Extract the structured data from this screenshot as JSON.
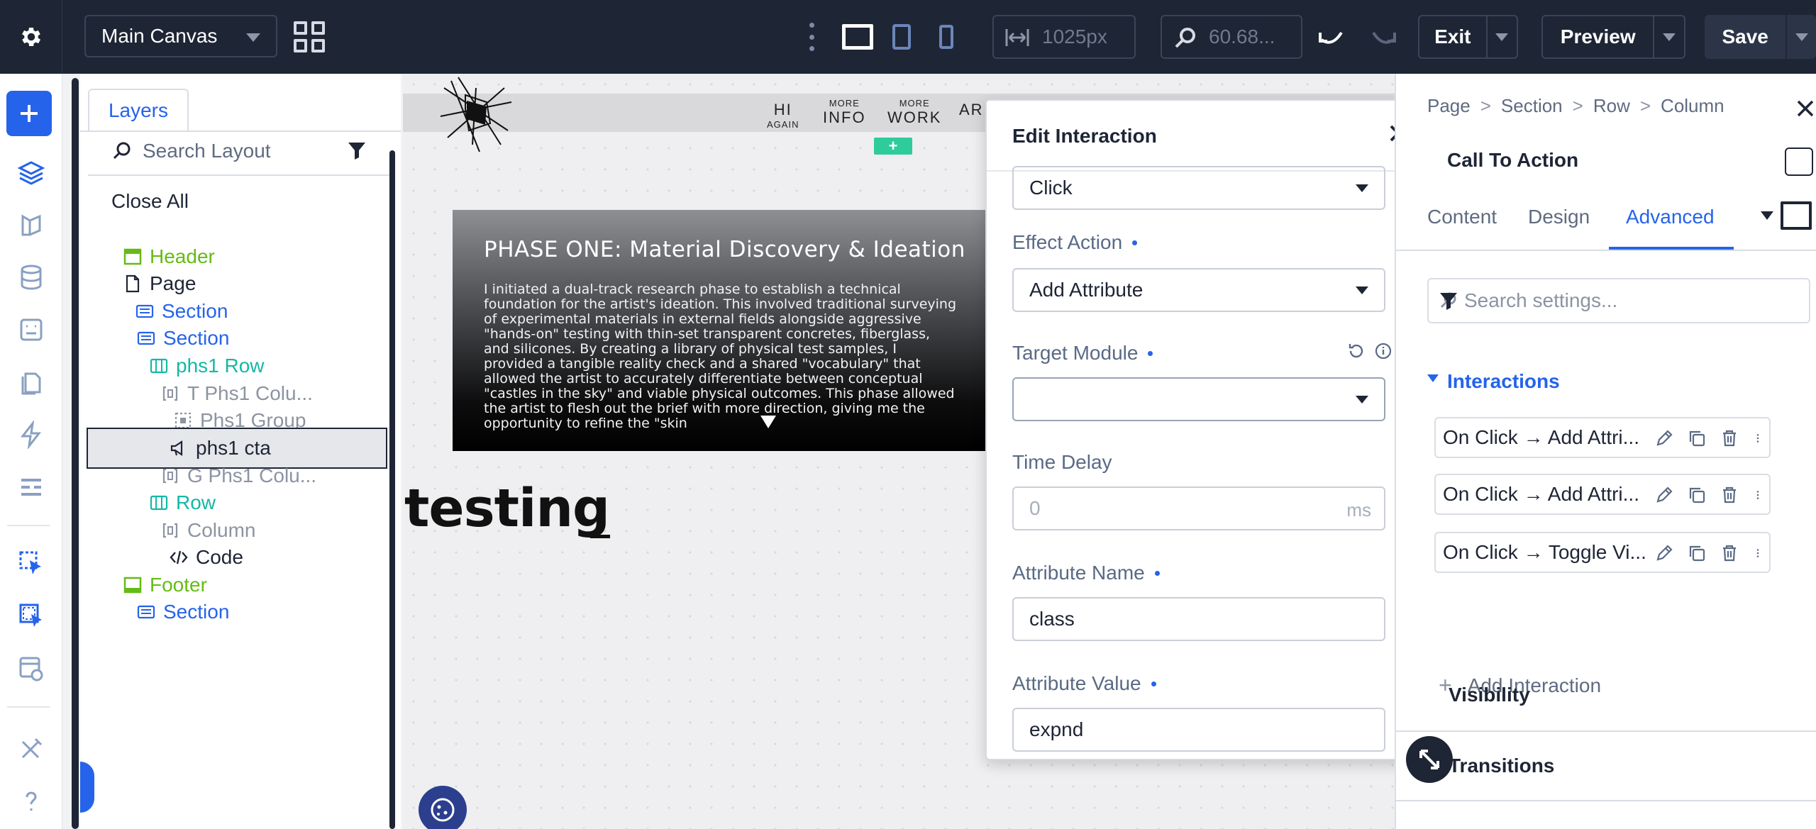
{
  "topbar": {
    "canvas_select": "Main Canvas",
    "width_value": "1025px",
    "zoom_value": "60.68...",
    "exit_label": "Exit",
    "preview_label": "Preview",
    "save_label": "Save"
  },
  "layers": {
    "tab_label": "Layers",
    "search_placeholder": "Search Layout",
    "close_all": "Close All",
    "items": [
      {
        "label": "Header",
        "icon": "header-icon",
        "color": "#65bb16"
      },
      {
        "label": "Page",
        "icon": "page-icon",
        "color": "#1e2535"
      },
      {
        "label": "Section",
        "icon": "section-icon",
        "color": "#2563eb"
      },
      {
        "label": "Section",
        "icon": "section-icon",
        "color": "#2563eb"
      },
      {
        "label": "phs1 Row",
        "icon": "row-icon",
        "color": "#14b8a6"
      },
      {
        "label": "T Phs1 Colu...",
        "icon": "column-icon",
        "color": "#8c94a2"
      },
      {
        "label": "Phs1 Group",
        "icon": "group-icon",
        "color": "#8c94a2"
      },
      {
        "label": "phs1 cta",
        "icon": "cta-icon",
        "color": "#1e2535"
      },
      {
        "label": "G Phs1 Colu...",
        "icon": "column-icon",
        "color": "#8c94a2"
      },
      {
        "label": "Row",
        "icon": "row-icon",
        "color": "#14b8a6"
      },
      {
        "label": "Column",
        "icon": "column-icon",
        "color": "#8c94a2"
      },
      {
        "label": "Code",
        "icon": "code-icon",
        "color": "#1e2535"
      },
      {
        "label": "Footer",
        "icon": "footer-icon",
        "color": "#65bb16"
      },
      {
        "label": "Section",
        "icon": "section-icon",
        "color": "#2563eb"
      }
    ]
  },
  "canvas": {
    "nav": [
      {
        "top": "",
        "main": "HI",
        "sub": "AGAIN"
      },
      {
        "top": "MORE",
        "main": "INFO",
        "sub": ""
      },
      {
        "top": "MORE",
        "main": "WORK",
        "sub": ""
      },
      {
        "top": "",
        "main": "AR",
        "sub": ""
      }
    ],
    "nav_add": "+",
    "phase_title": "PHASE ONE: Material Discovery & Ideation",
    "phase_body": "I initiated a dual-track research phase to establish a technical foundation for the artist's ideation. This involved traditional surveying of experimental materials in external fields alongside aggressive \"hands-on\" testing with thin-set transparent concretes, fiberglass, and silicones. By creating a library of physical test samples, I provided a tangible reality check and a shared \"vocabulary\" that allowed the artist to accurately differentiate between conceptual \"castles in the sky\" and viable physical outcomes. This phase allowed the artist to flesh out the brief with more direction, giving me the opportunity to refine the \"skin",
    "testing_text": "testing"
  },
  "modal": {
    "title": "Edit Interaction",
    "trigger_value": "Click",
    "effect_label": "Effect Action",
    "effect_value": "Add Attribute",
    "target_label": "Target Module",
    "target_value": "",
    "delay_label": "Time Delay",
    "delay_placeholder": "0",
    "delay_unit": "ms",
    "attr_name_label": "Attribute Name",
    "attr_name_value": "class",
    "attr_value_label": "Attribute Value",
    "attr_value_value": "expnd"
  },
  "settings": {
    "breadcrumb": [
      "Page",
      "Section",
      "Row",
      "Column"
    ],
    "module_name": "Call To Action",
    "tabs": [
      "Content",
      "Design",
      "Advanced"
    ],
    "active_tab": "Advanced",
    "search_placeholder": "Search settings...",
    "interactions_title": "Interactions",
    "interactions": [
      "On Click → Add Attri...",
      "On Click → Add Attri...",
      "On Click → Toggle Vi..."
    ],
    "add_interaction": "Add Interaction",
    "visibility_title": "Visibility",
    "transitions_title": "Transitions"
  },
  "colors": {
    "topbar_bg": "#1e2535",
    "accent": "#2563eb",
    "green": "#65bb16",
    "teal": "#14b8a6"
  }
}
